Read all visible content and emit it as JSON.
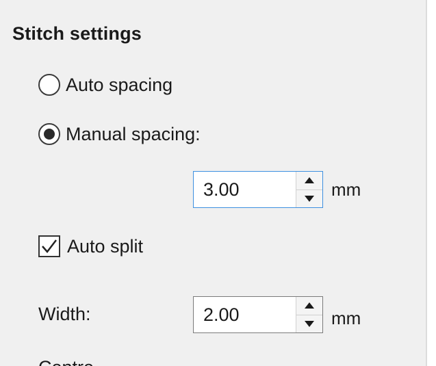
{
  "stitch_settings": {
    "title": "Stitch settings",
    "auto_spacing_label": "Auto spacing",
    "auto_spacing_selected": false,
    "manual_spacing_label": "Manual spacing:",
    "manual_spacing_selected": true,
    "spacing_value": "3.00",
    "spacing_unit": "mm",
    "auto_split_label": "Auto split",
    "auto_split_checked": true,
    "width_label": "Width:",
    "width_value": "2.00",
    "width_unit": "mm",
    "next_label_partial": "Centre"
  },
  "icons": {
    "spin_up": "chevron-up-icon",
    "spin_down": "chevron-down-icon",
    "check": "checkmark-icon"
  }
}
